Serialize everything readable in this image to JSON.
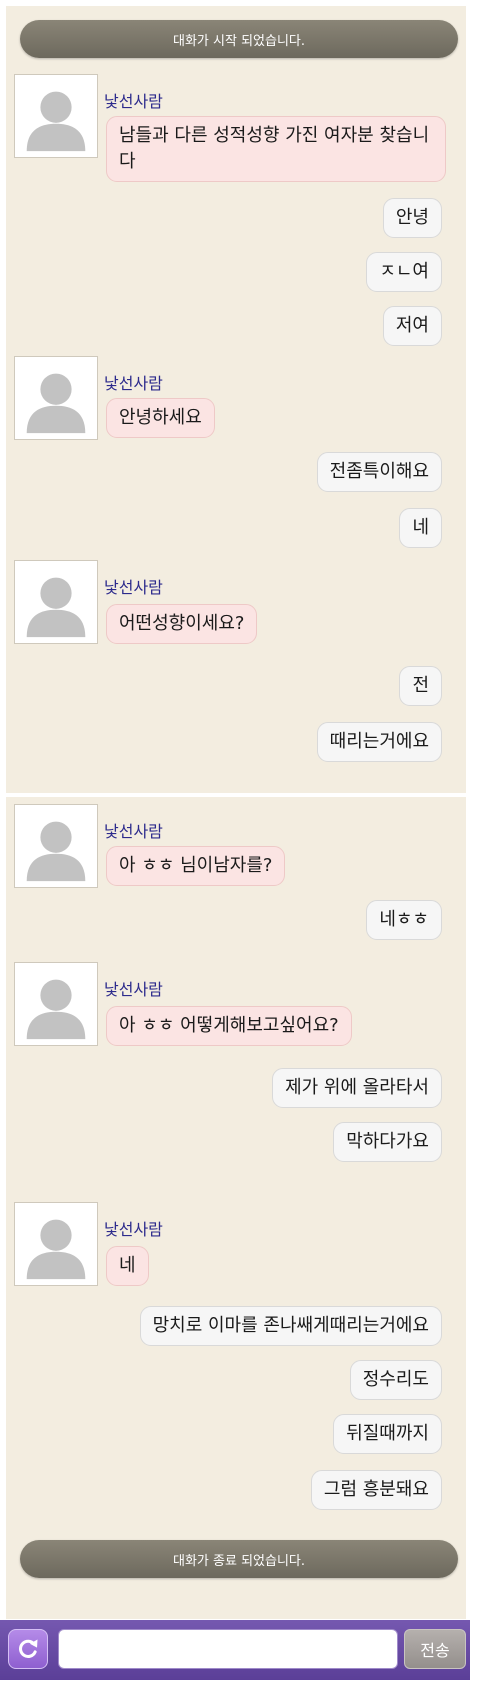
{
  "chat": {
    "start_notice": "대화가 시작 되었습니다.",
    "end_notice": "대화가 종료 되었습니다.",
    "stranger_name": "낯선사람",
    "messages": [
      {
        "from": "stranger",
        "text": "남들과 다른 성적성향 가진 여자분 찾습니다"
      },
      {
        "from": "me",
        "text": "안녕"
      },
      {
        "from": "me",
        "text": "ㅈㄴ여"
      },
      {
        "from": "me",
        "text": "저여"
      },
      {
        "from": "stranger",
        "text": "안녕하세요"
      },
      {
        "from": "me",
        "text": "전좀특이해요"
      },
      {
        "from": "me",
        "text": "네"
      },
      {
        "from": "stranger",
        "text": "어떤성향이세요?"
      },
      {
        "from": "me",
        "text": "전"
      },
      {
        "from": "me",
        "text": "때리는거에요"
      },
      {
        "from": "stranger",
        "text": "아 ㅎㅎ 님이남자를?"
      },
      {
        "from": "me",
        "text": "네ㅎㅎ"
      },
      {
        "from": "stranger",
        "text": "아 ㅎㅎ 어떻게해보고싶어요?"
      },
      {
        "from": "me",
        "text": "제가 위에 올라타서"
      },
      {
        "from": "me",
        "text": "막하다가요"
      },
      {
        "from": "stranger",
        "text": "네"
      },
      {
        "from": "me",
        "text": "망치로 이마를 존나쌔게때리는거에요"
      },
      {
        "from": "me",
        "text": "정수리도"
      },
      {
        "from": "me",
        "text": "뒤질때까지"
      },
      {
        "from": "me",
        "text": "그럼 흥분돼요"
      }
    ]
  },
  "input_bar": {
    "message_value": "",
    "send_label": "전송",
    "refresh_icon": "refresh-icon"
  },
  "colors": {
    "chat_background": "#f3ede0",
    "stranger_name": "#2c2a8c",
    "incoming_bubble": "#fbe4e3",
    "outgoing_bubble": "#f6f6f6",
    "input_bar": "#5b3f98"
  }
}
